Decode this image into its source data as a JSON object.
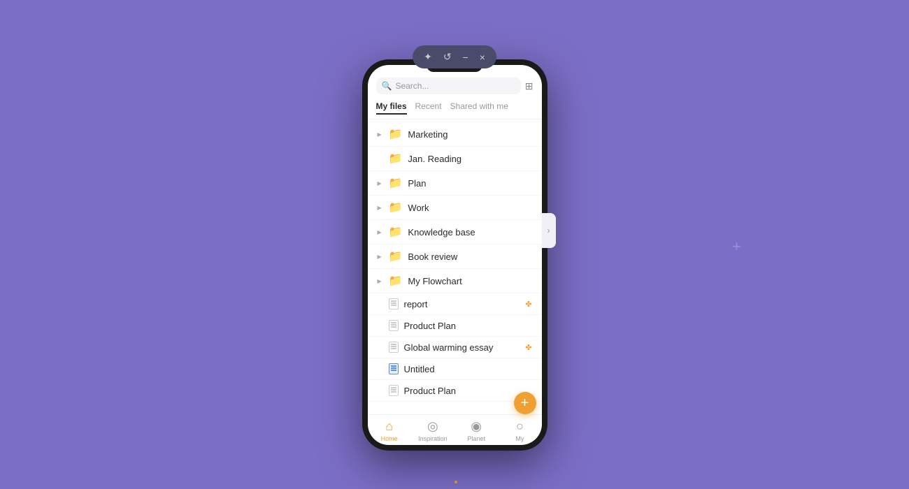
{
  "window_controls": {
    "sparkle": "✦",
    "history": "↺",
    "minimize": "−",
    "close": "×"
  },
  "search": {
    "placeholder": "Search..."
  },
  "tabs": [
    {
      "label": "My files",
      "active": true
    },
    {
      "label": "Recent",
      "active": false
    },
    {
      "label": "Shared with me",
      "active": false
    }
  ],
  "files": [
    {
      "type": "folder",
      "name": "Marketing",
      "hasChevron": true
    },
    {
      "type": "folder",
      "name": "Jan. Reading",
      "hasChevron": false
    },
    {
      "type": "folder",
      "name": "Plan",
      "hasChevron": true
    },
    {
      "type": "folder",
      "name": "Work",
      "hasChevron": true
    },
    {
      "type": "folder",
      "name": "Knowledge base",
      "hasChevron": true
    },
    {
      "type": "folder",
      "name": "Book review",
      "hasChevron": true
    },
    {
      "type": "folder",
      "name": "My Flowchart",
      "hasChevron": true
    },
    {
      "type": "doc",
      "name": "report",
      "hasShare": true
    },
    {
      "type": "doc",
      "name": "Product Plan",
      "hasShare": false
    },
    {
      "type": "doc",
      "name": "Global warming essay",
      "hasShare": true
    },
    {
      "type": "doc-blue",
      "name": "Untitled",
      "hasShare": false
    },
    {
      "type": "doc",
      "name": "Product Plan",
      "hasShare": false
    }
  ],
  "nav": [
    {
      "label": "Home",
      "active": true,
      "icon": "⌂"
    },
    {
      "label": "Inspiration",
      "active": false,
      "icon": "◎"
    },
    {
      "label": "Planet",
      "active": false,
      "icon": "◉"
    },
    {
      "label": "My",
      "active": false,
      "icon": "○"
    }
  ],
  "fab_label": "+",
  "colors": {
    "background": "#7b6ec6",
    "accent_orange": "#f0a030",
    "folder_yellow": "#f5c842"
  }
}
